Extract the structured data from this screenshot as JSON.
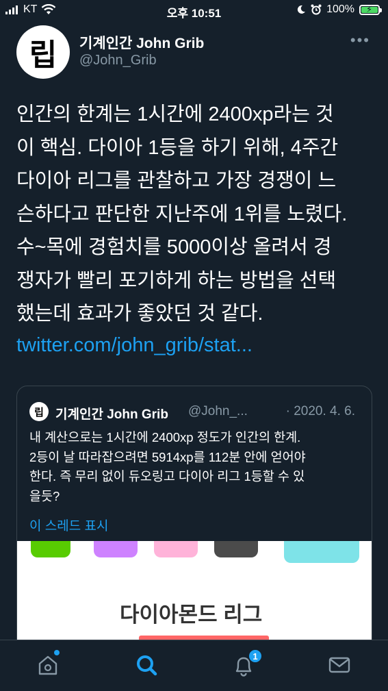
{
  "status_bar": {
    "carrier": "KT",
    "time": "오후 10:51",
    "battery": "100%",
    "battery_level": 1.0
  },
  "tweet": {
    "avatar_text": "립",
    "author_name": "기계인간 John Grib",
    "author_handle": "@John_Grib",
    "more_label": "•••",
    "text": "인간의 한계는 1시간에 2400xp라는 것\n이 핵심. 다이아 1등을 하기 위해, 4주간\n다이아 리그를 관찰하고 가장 경쟁이 느\n슨하다고 판단한 지난주에 1위를 노렸다.\n수~목에 경험치를 5000이상 올려서 경\n쟁자가 빨리 포기하게 하는 방법을 선택\n했는데 효과가 좋았던 것 같다.",
    "link": "twitter.com/john_grib/stat..."
  },
  "quote": {
    "avatar_text": "립",
    "author_name": "기계인간 John Grib",
    "author_handle": "@John_...",
    "date": "· 2020. 4. 6.",
    "text": "내 계산으로는 1시간에 2400xp 정도가 인간의 한계.\n2등이 날 따라잡으려면 5914xp를 112분 안에 얻어야\n한다. 즉 무리 없이 듀오링고 다이아 리그 1등할 수 있\n을듯?",
    "thread_link": "이 스레드 표시",
    "image": {
      "title": "다이아몬드 리그",
      "hex_colors": [
        "#58cc02",
        "#ce82ff",
        "#ffb3d9",
        "#4b4b4b",
        "#7ee3e8"
      ]
    }
  },
  "tab_bar": {
    "icons": [
      "home-icon",
      "search-icon",
      "notifications-icon",
      "messages-icon"
    ],
    "notification_count": "1",
    "active_color": "#1da1f2",
    "inactive_color": "#8899a6"
  }
}
